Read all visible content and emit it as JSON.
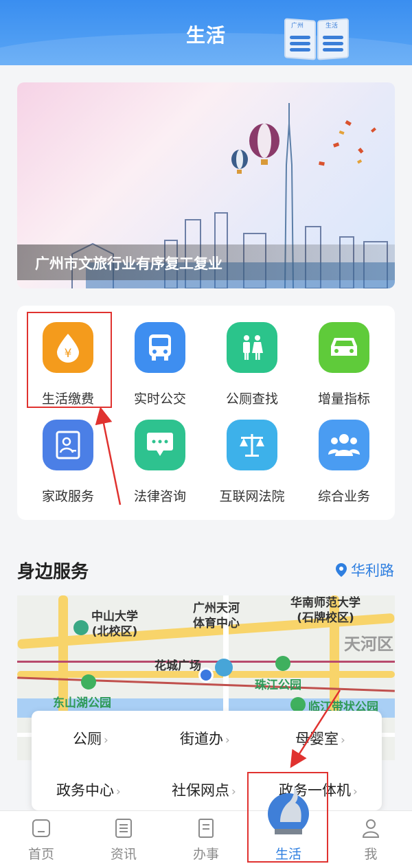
{
  "header": {
    "title": "生活",
    "book_left": "广州",
    "book_right": "生活"
  },
  "banner": {
    "caption": "广州市文旅行业有序复工复业"
  },
  "services": [
    {
      "label": "生活缴费",
      "icon": "yuan-drop-icon",
      "color": "#f49b1c"
    },
    {
      "label": "实时公交",
      "icon": "bus-icon",
      "color": "#3e8ef0"
    },
    {
      "label": "公厕查找",
      "icon": "restroom-icon",
      "color": "#2bc48b"
    },
    {
      "label": "增量指标",
      "icon": "car-icon",
      "color": "#5fcb3a"
    },
    {
      "label": "家政服务",
      "icon": "id-card-icon",
      "color": "#4b7fe6"
    },
    {
      "label": "法律咨询",
      "icon": "chat-icon",
      "color": "#2ec28f"
    },
    {
      "label": "互联网法院",
      "icon": "scales-icon",
      "color": "#3db1ea"
    },
    {
      "label": "综合业务",
      "icon": "users-icon",
      "color": "#4a9cf2"
    }
  ],
  "nearby": {
    "title": "身边服务",
    "location": "华利路"
  },
  "map": {
    "places": [
      "中山大学\n(北校区)",
      "广州天河\n体育中心",
      "华南师范大学\n(石牌校区)",
      "花城广场",
      "天河区"
    ],
    "parks": [
      "东山湖公园",
      "珠江公园",
      "临江带状公园"
    ]
  },
  "popup": {
    "row1": [
      "公厕",
      "街道办",
      "母婴室"
    ],
    "row2": [
      "政务中心",
      "社保网点",
      "政务一体机"
    ]
  },
  "tabs": [
    {
      "label": "首页",
      "icon": "home-icon"
    },
    {
      "label": "资讯",
      "icon": "news-icon"
    },
    {
      "label": "办事",
      "icon": "task-icon"
    },
    {
      "label": "生活",
      "icon": "life-icon"
    },
    {
      "label": "我",
      "icon": "profile-icon"
    }
  ],
  "colors": {
    "accent": "#2f7fe0",
    "highlight": "#e0322f",
    "header": "#3a8ef0"
  }
}
